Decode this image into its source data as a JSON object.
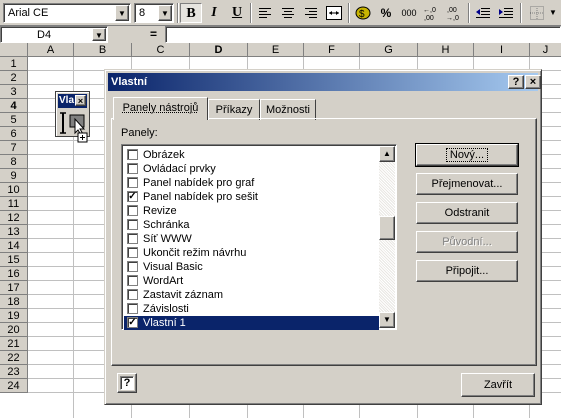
{
  "toolbar": {
    "font_name": "Arial CE",
    "font_size": "8",
    "bold_label": "B",
    "italic_label": "I",
    "underline_label": "U",
    "percent_label": "%",
    "thousands_label": "000",
    "inc_decimal_label": "+,0\n,00",
    "dec_decimal_label": ",00\n+,0"
  },
  "formula_bar": {
    "name_box": "D4",
    "equals": "="
  },
  "grid": {
    "columns": [
      "A",
      "B",
      "C",
      "D",
      "E",
      "F",
      "G",
      "H",
      "I",
      "J"
    ],
    "rows": [
      "1",
      "2",
      "3",
      "4",
      "5",
      "6",
      "7",
      "8",
      "9",
      "10",
      "11",
      "12",
      "13",
      "14",
      "15",
      "16",
      "17",
      "18",
      "19",
      "20",
      "21",
      "22",
      "23",
      "24"
    ]
  },
  "floating_toolbar": {
    "title": "Vla"
  },
  "dialog": {
    "title": "Vlastní",
    "help_button": "?",
    "close_button": "×",
    "tabs": [
      {
        "label": "Panely nástrojů",
        "active": true
      },
      {
        "label": "Příkazy",
        "active": false
      },
      {
        "label": "Možnosti",
        "active": false
      }
    ],
    "list_label": "Panely:",
    "list_items": [
      {
        "label": "Obrázek",
        "checked": false,
        "selected": false
      },
      {
        "label": "Ovládací prvky",
        "checked": false,
        "selected": false
      },
      {
        "label": "Panel nabídek pro graf",
        "checked": false,
        "selected": false
      },
      {
        "label": "Panel nabídek pro sešit",
        "checked": true,
        "selected": false
      },
      {
        "label": "Revize",
        "checked": false,
        "selected": false
      },
      {
        "label": "Schránka",
        "checked": false,
        "selected": false
      },
      {
        "label": "Síť WWW",
        "checked": false,
        "selected": false
      },
      {
        "label": "Ukončit režim návrhu",
        "checked": false,
        "selected": false
      },
      {
        "label": "Visual Basic",
        "checked": false,
        "selected": false
      },
      {
        "label": "WordArt",
        "checked": false,
        "selected": false
      },
      {
        "label": "Zastavit záznam",
        "checked": false,
        "selected": false
      },
      {
        "label": "Závislosti",
        "checked": false,
        "selected": false
      },
      {
        "label": "Vlastní 1",
        "checked": true,
        "selected": true
      }
    ],
    "buttons": {
      "new": "Nový...",
      "rename": "Přejmenovat...",
      "delete": "Odstranit",
      "reset": "Původní...",
      "attach": "Připojit..."
    },
    "close_label": "Zavřít",
    "help_icon_label": "?"
  }
}
